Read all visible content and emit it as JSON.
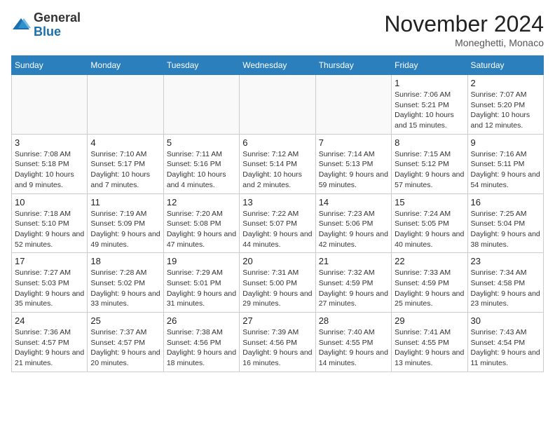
{
  "header": {
    "logo_general": "General",
    "logo_blue": "Blue",
    "month_title": "November 2024",
    "location": "Moneghetti, Monaco"
  },
  "days_of_week": [
    "Sunday",
    "Monday",
    "Tuesday",
    "Wednesday",
    "Thursday",
    "Friday",
    "Saturday"
  ],
  "weeks": [
    [
      {
        "day": "",
        "info": ""
      },
      {
        "day": "",
        "info": ""
      },
      {
        "day": "",
        "info": ""
      },
      {
        "day": "",
        "info": ""
      },
      {
        "day": "",
        "info": ""
      },
      {
        "day": "1",
        "info": "Sunrise: 7:06 AM\nSunset: 5:21 PM\nDaylight: 10 hours and 15 minutes."
      },
      {
        "day": "2",
        "info": "Sunrise: 7:07 AM\nSunset: 5:20 PM\nDaylight: 10 hours and 12 minutes."
      }
    ],
    [
      {
        "day": "3",
        "info": "Sunrise: 7:08 AM\nSunset: 5:18 PM\nDaylight: 10 hours and 9 minutes."
      },
      {
        "day": "4",
        "info": "Sunrise: 7:10 AM\nSunset: 5:17 PM\nDaylight: 10 hours and 7 minutes."
      },
      {
        "day": "5",
        "info": "Sunrise: 7:11 AM\nSunset: 5:16 PM\nDaylight: 10 hours and 4 minutes."
      },
      {
        "day": "6",
        "info": "Sunrise: 7:12 AM\nSunset: 5:14 PM\nDaylight: 10 hours and 2 minutes."
      },
      {
        "day": "7",
        "info": "Sunrise: 7:14 AM\nSunset: 5:13 PM\nDaylight: 9 hours and 59 minutes."
      },
      {
        "day": "8",
        "info": "Sunrise: 7:15 AM\nSunset: 5:12 PM\nDaylight: 9 hours and 57 minutes."
      },
      {
        "day": "9",
        "info": "Sunrise: 7:16 AM\nSunset: 5:11 PM\nDaylight: 9 hours and 54 minutes."
      }
    ],
    [
      {
        "day": "10",
        "info": "Sunrise: 7:18 AM\nSunset: 5:10 PM\nDaylight: 9 hours and 52 minutes."
      },
      {
        "day": "11",
        "info": "Sunrise: 7:19 AM\nSunset: 5:09 PM\nDaylight: 9 hours and 49 minutes."
      },
      {
        "day": "12",
        "info": "Sunrise: 7:20 AM\nSunset: 5:08 PM\nDaylight: 9 hours and 47 minutes."
      },
      {
        "day": "13",
        "info": "Sunrise: 7:22 AM\nSunset: 5:07 PM\nDaylight: 9 hours and 44 minutes."
      },
      {
        "day": "14",
        "info": "Sunrise: 7:23 AM\nSunset: 5:06 PM\nDaylight: 9 hours and 42 minutes."
      },
      {
        "day": "15",
        "info": "Sunrise: 7:24 AM\nSunset: 5:05 PM\nDaylight: 9 hours and 40 minutes."
      },
      {
        "day": "16",
        "info": "Sunrise: 7:25 AM\nSunset: 5:04 PM\nDaylight: 9 hours and 38 minutes."
      }
    ],
    [
      {
        "day": "17",
        "info": "Sunrise: 7:27 AM\nSunset: 5:03 PM\nDaylight: 9 hours and 35 minutes."
      },
      {
        "day": "18",
        "info": "Sunrise: 7:28 AM\nSunset: 5:02 PM\nDaylight: 9 hours and 33 minutes."
      },
      {
        "day": "19",
        "info": "Sunrise: 7:29 AM\nSunset: 5:01 PM\nDaylight: 9 hours and 31 minutes."
      },
      {
        "day": "20",
        "info": "Sunrise: 7:31 AM\nSunset: 5:00 PM\nDaylight: 9 hours and 29 minutes."
      },
      {
        "day": "21",
        "info": "Sunrise: 7:32 AM\nSunset: 4:59 PM\nDaylight: 9 hours and 27 minutes."
      },
      {
        "day": "22",
        "info": "Sunrise: 7:33 AM\nSunset: 4:59 PM\nDaylight: 9 hours and 25 minutes."
      },
      {
        "day": "23",
        "info": "Sunrise: 7:34 AM\nSunset: 4:58 PM\nDaylight: 9 hours and 23 minutes."
      }
    ],
    [
      {
        "day": "24",
        "info": "Sunrise: 7:36 AM\nSunset: 4:57 PM\nDaylight: 9 hours and 21 minutes."
      },
      {
        "day": "25",
        "info": "Sunrise: 7:37 AM\nSunset: 4:57 PM\nDaylight: 9 hours and 20 minutes."
      },
      {
        "day": "26",
        "info": "Sunrise: 7:38 AM\nSunset: 4:56 PM\nDaylight: 9 hours and 18 minutes."
      },
      {
        "day": "27",
        "info": "Sunrise: 7:39 AM\nSunset: 4:56 PM\nDaylight: 9 hours and 16 minutes."
      },
      {
        "day": "28",
        "info": "Sunrise: 7:40 AM\nSunset: 4:55 PM\nDaylight: 9 hours and 14 minutes."
      },
      {
        "day": "29",
        "info": "Sunrise: 7:41 AM\nSunset: 4:55 PM\nDaylight: 9 hours and 13 minutes."
      },
      {
        "day": "30",
        "info": "Sunrise: 7:43 AM\nSunset: 4:54 PM\nDaylight: 9 hours and 11 minutes."
      }
    ]
  ]
}
